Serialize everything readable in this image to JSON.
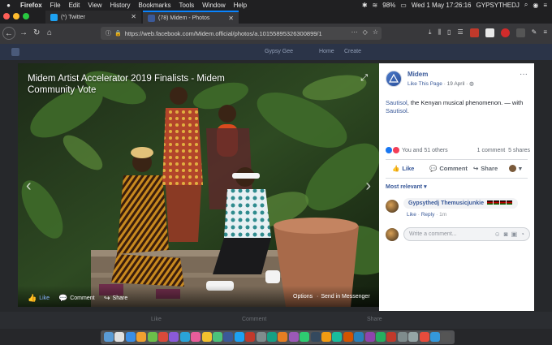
{
  "menubar": {
    "app": "Firefox",
    "items": [
      "File",
      "Edit",
      "View",
      "History",
      "Bookmarks",
      "Tools",
      "Window",
      "Help"
    ],
    "battery": "98%",
    "clock": "Wed 1 May  17:26:16",
    "user": "GYPSYTHEDJ"
  },
  "tabs": [
    {
      "title": "(*) Twitter"
    },
    {
      "title": "(78) Midem - Photos"
    }
  ],
  "url": "https://web.facebook.com/Midem.official/photos/a.10155895326300899/1",
  "fbbar": {
    "search": "Gypsy Gee",
    "home": "Home",
    "create": "Create"
  },
  "photo": {
    "title": "Midem Artist Accelerator 2019 Finalists - Midem Community Vote",
    "actions": {
      "like": "Like",
      "comment": "Comment",
      "share": "Share",
      "options": "Options",
      "send": "Send in Messenger"
    }
  },
  "post": {
    "page_name": "Midem",
    "like_page": "Like This Page",
    "date": "· 19 April ·",
    "caption_link1": "Sautisol",
    "caption_text": ", the Kenyan musical phenomenon. — with ",
    "caption_link2": "Sautisol",
    "caption_end": ".",
    "reactions": "You and 51 others",
    "comments_count": "1 comment",
    "shares_count": "5 shares",
    "like": "Like",
    "comment": "Comment",
    "share": "Share",
    "most_relevant": "Most relevant ▾"
  },
  "comment": {
    "author": "Gypsythedj Themusicjunkie",
    "like": "Like",
    "reply": "Reply",
    "time": "1m"
  },
  "write_placeholder": "Write a comment...",
  "ghost": {
    "like": "Like",
    "comment": "Comment",
    "share": "Share"
  }
}
